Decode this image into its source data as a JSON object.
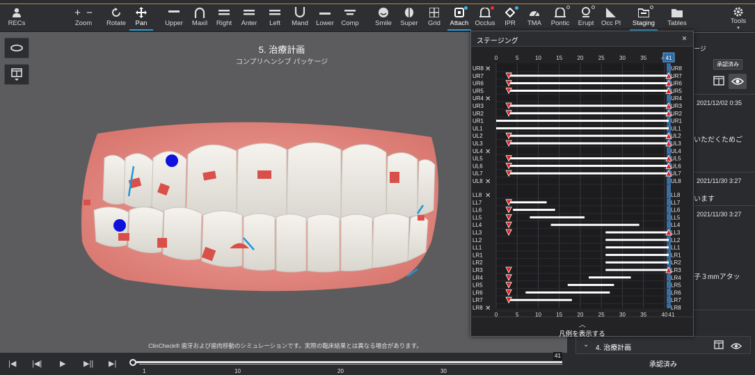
{
  "toolbar": {
    "recs": "RECs",
    "zoom": "Zoom",
    "rotate": "Rotate",
    "pan": "Pan",
    "upper": "Upper",
    "maxil": "Maxil",
    "right": "Right",
    "anter": "Anter",
    "left": "Left",
    "mand": "Mand",
    "lower": "Lower",
    "comp": "Comp",
    "smile": "Smile",
    "super": "Super",
    "grid": "Grid",
    "attach": "Attach",
    "occlus": "Occlus",
    "ipr": "IPR",
    "tma": "TMA",
    "pontic": "Pontic",
    "erupt": "Erupt",
    "occpl": "Occ Pl",
    "staging": "Staging",
    "tables": "Tables",
    "tools": "Tools"
  },
  "viewport": {
    "title": "5. 治療計画",
    "subtitle": "コンプリヘンシブ パッケージ",
    "disclaimer": "ClinCheck® 歯牙および歯肉移動のシミュレーションです。実際の臨床結果とは異なる場合があります。"
  },
  "playback": {
    "max_stage": "41",
    "ticks": [
      "1",
      "10",
      "20",
      "30"
    ]
  },
  "right_panel": {
    "frag1": "ージ",
    "approved_badge": "承認済み",
    "date1": "2021/12/02 0:35",
    "text1": "いただくためご",
    "date2": "2021/11/30 3:27",
    "text2": "います",
    "date3": "2021/11/30 3:27",
    "text3": "子３mmアタッ",
    "section": "4. 治療計画",
    "approved_footer": "承認済み"
  },
  "staging": {
    "title": "ステージング",
    "close": "×",
    "legend_button": "凡例を表示する",
    "final_stage": "41",
    "axis_ticks": [
      "0",
      "5",
      "10",
      "15",
      "20",
      "25",
      "30",
      "35",
      "40"
    ],
    "bottom_axis_ticks": [
      "0",
      "5",
      "10",
      "15",
      "20",
      "25",
      "30",
      "35",
      "40",
      "41"
    ]
  },
  "chart_data": {
    "type": "gantt",
    "title": "ステージング",
    "x_axis": {
      "min": 0,
      "max": 41,
      "ticks": [
        0,
        5,
        10,
        15,
        20,
        25,
        30,
        35,
        40
      ]
    },
    "upper": [
      {
        "tooth": "UR8",
        "missing": true
      },
      {
        "tooth": "UR7",
        "start": 3,
        "end": 41,
        "attach": true
      },
      {
        "tooth": "UR6",
        "start": 3,
        "end": 41,
        "attach": true
      },
      {
        "tooth": "UR5",
        "start": 3,
        "end": 41,
        "attach": true
      },
      {
        "tooth": "UR4",
        "missing": true
      },
      {
        "tooth": "UR3",
        "start": 3,
        "end": 41,
        "attach": true
      },
      {
        "tooth": "UR2",
        "start": 3,
        "end": 41,
        "attach": true
      },
      {
        "tooth": "UR1",
        "start": 0,
        "end": 41,
        "attach": false
      },
      {
        "tooth": "UL1",
        "start": 0,
        "end": 41,
        "attach": false
      },
      {
        "tooth": "UL2",
        "start": 3,
        "end": 41,
        "attach": true
      },
      {
        "tooth": "UL3",
        "start": 3,
        "end": 41,
        "attach": true
      },
      {
        "tooth": "UL4",
        "missing": true
      },
      {
        "tooth": "UL5",
        "start": 3,
        "end": 41,
        "attach": true
      },
      {
        "tooth": "UL6",
        "start": 3,
        "end": 41,
        "attach": true
      },
      {
        "tooth": "UL7",
        "start": 3,
        "end": 41,
        "attach": true
      },
      {
        "tooth": "UL8",
        "missing": true
      }
    ],
    "lower": [
      {
        "tooth": "LL8",
        "missing": true
      },
      {
        "tooth": "LL7",
        "start": 3,
        "end": 12,
        "attach": true
      },
      {
        "tooth": "LL6",
        "start": 4,
        "end": 14,
        "attach": true
      },
      {
        "tooth": "LL5",
        "start": 8,
        "end": 21,
        "attach": true
      },
      {
        "tooth": "LL4",
        "start": 13,
        "end": 34,
        "attach": true
      },
      {
        "tooth": "LL3",
        "start": 26,
        "end": 41,
        "attach": true
      },
      {
        "tooth": "LL2",
        "start": 26,
        "end": 41,
        "attach": false
      },
      {
        "tooth": "LL1",
        "start": 26,
        "end": 41,
        "attach": false
      },
      {
        "tooth": "LR1",
        "start": 26,
        "end": 41,
        "attach": false
      },
      {
        "tooth": "LR2",
        "start": 26,
        "end": 41,
        "attach": false
      },
      {
        "tooth": "LR3",
        "start": 26,
        "end": 41,
        "attach": true
      },
      {
        "tooth": "LR4",
        "start": 22,
        "end": 32,
        "attach": true
      },
      {
        "tooth": "LR5",
        "start": 17,
        "end": 28,
        "attach": true
      },
      {
        "tooth": "LR6",
        "start": 7,
        "end": 27,
        "attach": true
      },
      {
        "tooth": "LR7",
        "start": 3,
        "end": 18,
        "attach": true
      },
      {
        "tooth": "LR8",
        "missing": true
      }
    ]
  },
  "colors": {
    "accent": "#2b9bd6",
    "attachment": "#e02020",
    "bar": "#ffffff",
    "stage_marker": "#3a6fa0"
  }
}
